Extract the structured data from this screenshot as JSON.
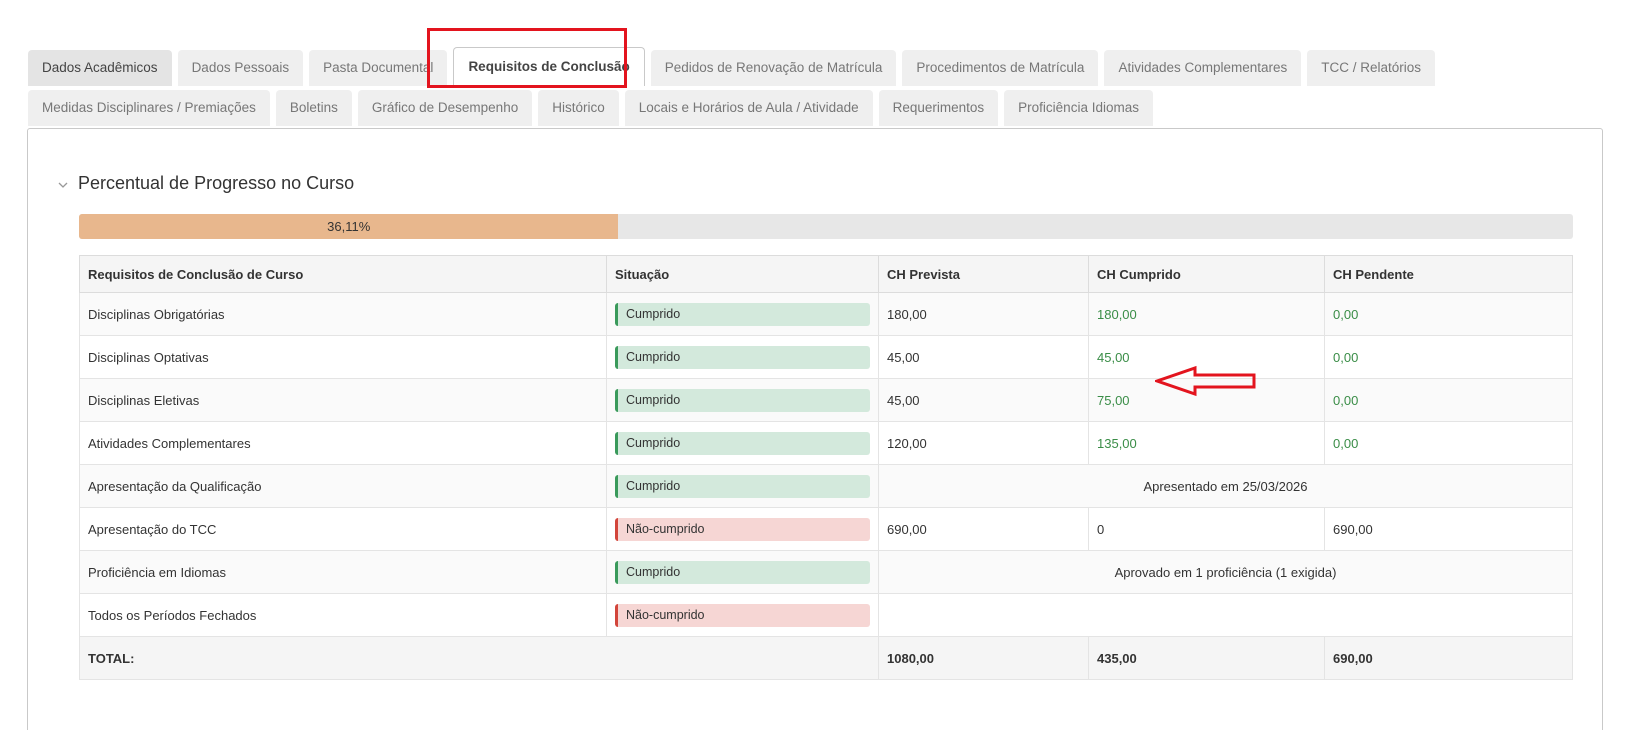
{
  "tabs_row1": [
    {
      "label": "Dados Acadêmicos"
    },
    {
      "label": "Dados Pessoais"
    },
    {
      "label": "Pasta Documental"
    },
    {
      "label": "Requisitos de Conclusão"
    },
    {
      "label": "Pedidos de Renovação de Matrícula"
    },
    {
      "label": "Procedimentos de Matrícula"
    },
    {
      "label": "Atividades Complementares"
    },
    {
      "label": "TCC / Relatórios"
    }
  ],
  "tabs_row2": [
    {
      "label": "Medidas Disciplinares / Premiações"
    },
    {
      "label": "Boletins"
    },
    {
      "label": "Gráfico de Desempenho"
    },
    {
      "label": "Histórico"
    },
    {
      "label": "Locais e Horários de Aula / Atividade"
    },
    {
      "label": "Requerimentos"
    },
    {
      "label": "Proficiência Idiomas"
    }
  ],
  "section": {
    "title": "Percentual de Progresso no Curso",
    "progress_label": "36,11%",
    "progress_value": 36.11
  },
  "table": {
    "headers": [
      "Requisitos de Conclusão de Curso",
      "Situação",
      "CH Prevista",
      "CH Cumprido",
      "CH Pendente"
    ],
    "rows": [
      {
        "req": "Disciplinas Obrigatórias",
        "status": "Cumprido",
        "prev": "180,00",
        "cump": "180,00",
        "pend": "0,00"
      },
      {
        "req": "Disciplinas Optativas",
        "status": "Cumprido",
        "prev": "45,00",
        "cump": "45,00",
        "pend": "0,00"
      },
      {
        "req": "Disciplinas Eletivas",
        "status": "Cumprido",
        "prev": "45,00",
        "cump": "75,00",
        "pend": "0,00"
      },
      {
        "req": "Atividades Complementares",
        "status": "Cumprido",
        "prev": "120,00",
        "cump": "135,00",
        "pend": "0,00"
      },
      {
        "req": "Apresentação da Qualificação",
        "status": "Cumprido",
        "note": "Apresentado em 25/03/2026"
      },
      {
        "req": "Apresentação do TCC",
        "status": "Não-cumprido",
        "prev": "690,00",
        "cump": "0",
        "pend": "690,00"
      },
      {
        "req": "Proficiência em Idiomas",
        "status": "Cumprido",
        "note": "Aprovado em 1 proficiência (1 exigida)"
      },
      {
        "req": "Todos os Períodos Fechados",
        "status": "Não-cumprido",
        "note": ""
      }
    ],
    "total": {
      "label": "TOTAL:",
      "prev": "1080,00",
      "cump": "435,00",
      "pend": "690,00"
    }
  },
  "colors": {
    "highlight": "#e3141e",
    "progress_fill": "#e8b78d",
    "ok_badge": "#d3e9dc",
    "no_badge": "#f6d6d4",
    "green_text": "#3a8d47"
  }
}
